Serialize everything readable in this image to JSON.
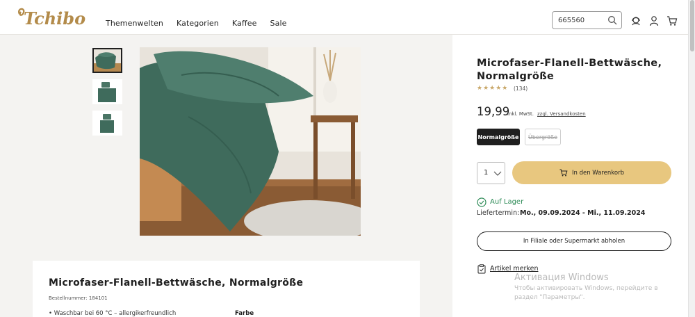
{
  "header": {
    "logo_text": "Tchibo",
    "nav": [
      "Themenwelten",
      "Kategorien",
      "Kaffee",
      "Sale"
    ],
    "search_value": "665560"
  },
  "gallery": {
    "thumbnail_count": 3,
    "active_index": 0
  },
  "product": {
    "title": "Microfaser-Flanell-Bettwäsche, Normalgröße",
    "rating": 4.5,
    "review_count": "(134)",
    "price": "19,99",
    "price_note": "inkl. MwSt.",
    "shipping_link": "zzgl. Versandkosten",
    "sizes": [
      {
        "label": "Normalgröße",
        "selected": true
      },
      {
        "label": "Übergröße",
        "available": false
      }
    ],
    "quantity": "1",
    "add_to_cart": "In den Warenkorb",
    "stock": "Auf Lager",
    "delivery_label": "Liefertermin:",
    "delivery_date": "Mo., 09.09.2024 - Mi., 11.09.2024",
    "pickup": "In Filiale oder Supermarkt abholen",
    "wishlist": "Artikel merken"
  },
  "description": {
    "title": "Microfaser-Flanell-Bettwäsche, Normalgröße",
    "order_number": "Bestellnummer: 184101",
    "bullet": "Waschbar bei 60 °C – allergikerfreundlich",
    "color_label": "Farbe"
  },
  "windows_overlay": {
    "title": "Активация Windows",
    "subtitle": "Чтобы активировать Windows, перейдите в раздел \"Параметры\"."
  },
  "colors": {
    "accent": "#e8c77f",
    "brand": "#b38b4a",
    "stock_green": "#2e8b57",
    "bedding_green": "#3f6b5c"
  }
}
